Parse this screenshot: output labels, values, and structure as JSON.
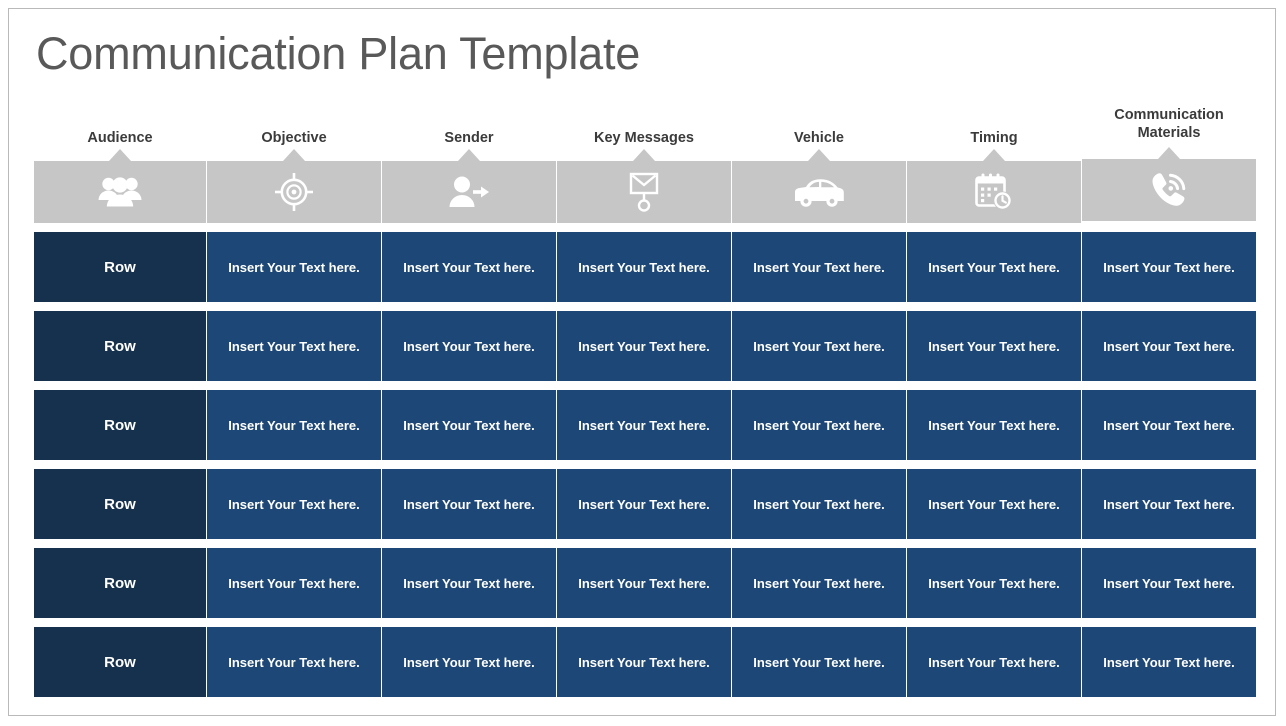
{
  "slide": {
    "title": "Communication Plan Template",
    "colors": {
      "title_text": "#595959",
      "header_gray": "#c6c6c6",
      "header_label_text": "#3b3b3b",
      "row_label_navy": "#16314d",
      "cell_blue": "#1d4776",
      "cell_text": "#ffffff",
      "frame_border": "#b9b9b9",
      "background": "#ffffff"
    }
  },
  "table": {
    "columns": [
      {
        "label": "Audience",
        "icon": "people-group-icon"
      },
      {
        "label": "Objective",
        "icon": "target-crosshair-icon"
      },
      {
        "label": "Sender",
        "icon": "person-arrow-icon"
      },
      {
        "label": "Key Messages",
        "icon": "envelope-pin-icon"
      },
      {
        "label": "Vehicle",
        "icon": "car-icon"
      },
      {
        "label": "Timing",
        "icon": "calendar-clock-icon"
      },
      {
        "label": "Communication Materials",
        "icon": "phone-waves-icon"
      }
    ],
    "row_label": "Row",
    "cell_placeholder": "Insert Your Text here.",
    "rows": [
      {
        "label": "Row",
        "cells": [
          "Insert Your Text here.",
          "Insert Your Text here.",
          "Insert Your Text here.",
          "Insert Your Text here.",
          "Insert Your Text here.",
          "Insert Your Text here."
        ]
      },
      {
        "label": "Row",
        "cells": [
          "Insert Your Text here.",
          "Insert Your Text here.",
          "Insert Your Text here.",
          "Insert Your Text here.",
          "Insert Your Text here.",
          "Insert Your Text here."
        ]
      },
      {
        "label": "Row",
        "cells": [
          "Insert Your Text here.",
          "Insert Your Text here.",
          "Insert Your Text here.",
          "Insert Your Text here.",
          "Insert Your Text here.",
          "Insert Your Text here."
        ]
      },
      {
        "label": "Row",
        "cells": [
          "Insert Your Text here.",
          "Insert Your Text here.",
          "Insert Your Text here.",
          "Insert Your Text here.",
          "Insert Your Text here.",
          "Insert Your Text here."
        ]
      },
      {
        "label": "Row",
        "cells": [
          "Insert Your Text here.",
          "Insert Your Text here.",
          "Insert Your Text here.",
          "Insert Your Text here.",
          "Insert Your Text here.",
          "Insert Your Text here."
        ]
      },
      {
        "label": "Row",
        "cells": [
          "Insert Your Text here.",
          "Insert Your Text here.",
          "Insert Your Text here.",
          "Insert Your Text here.",
          "Insert Your Text here.",
          "Insert Your Text here."
        ]
      }
    ]
  }
}
